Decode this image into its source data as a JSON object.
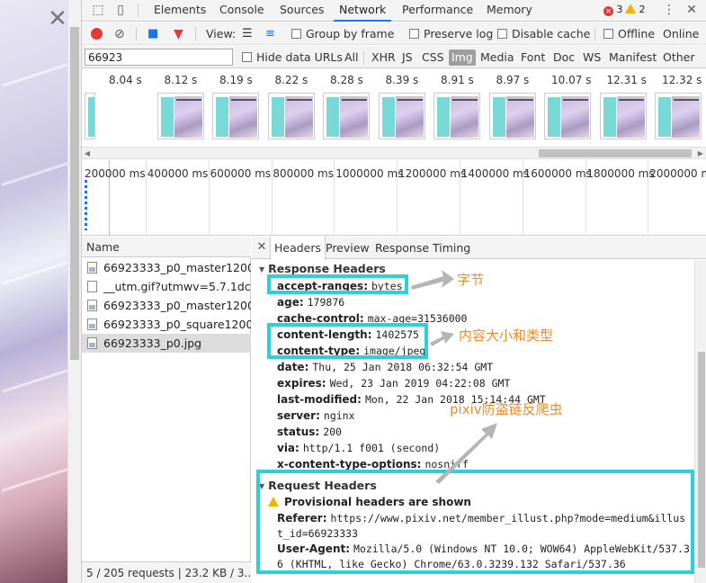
{
  "page": {
    "close_glyph": "✕"
  },
  "devtools": {
    "main_tabs": [
      "Elements",
      "Console",
      "Sources",
      "Network",
      "Performance",
      "Memory"
    ],
    "active_tab": "Network",
    "error_count": "3",
    "warning_count": "2",
    "more_glyph": "⋮",
    "close_glyph": "✕"
  },
  "toolbar": {
    "view_label": "View:",
    "group_by_frame": "Group by frame",
    "preserve_log": "Preserve log",
    "disable_cache": "Disable cache",
    "offline": "Offline",
    "online": "Online"
  },
  "filter": {
    "value": "66923",
    "hide_data_urls": "Hide data URLs",
    "types": [
      "All",
      "XHR",
      "JS",
      "CSS",
      "Img",
      "Media",
      "Font",
      "Doc",
      "WS",
      "Manifest",
      "Other"
    ],
    "active_type": "Img"
  },
  "filmstrip": {
    "times": [
      "8.04 s",
      "8.12 s",
      "8.19 s",
      "8.22 s",
      "8.28 s",
      "8.39 s",
      "8.91 s",
      "8.97 s",
      "10.07 s",
      "12.31 s",
      "12.32 s"
    ]
  },
  "timeline": {
    "ticks": [
      "200000 ms",
      "400000 ms",
      "600000 ms",
      "800000 ms",
      "1000000 ms",
      "1200000 ms",
      "1400000 ms",
      "1600000 ms",
      "1800000 ms",
      "2000000 ms"
    ]
  },
  "request_list": {
    "header": "Name",
    "rows": [
      {
        "name": "66923333_p0_master1200...",
        "icon": "image-file-icon"
      },
      {
        "name": "__utm.gif?utmwv=5.7.1dc...",
        "icon": "blank-file-icon"
      },
      {
        "name": "66923333_p0_master1200...",
        "icon": "image-file-icon"
      },
      {
        "name": "66923333_p0_square1200...",
        "icon": "image-file-icon"
      },
      {
        "name": "66923333_p0.jpg",
        "icon": "image-file-icon"
      }
    ],
    "status": "5 / 205 requests | 23.2 KB / 3..."
  },
  "details": {
    "close_glyph": "✕",
    "tabs": [
      "Headers",
      "Preview",
      "Response",
      "Timing"
    ],
    "active_tab": "Headers",
    "response_headers_title": "Response Headers",
    "response_headers": [
      {
        "k": "accept-ranges:",
        "v": "bytes"
      },
      {
        "k": "age:",
        "v": "179876"
      },
      {
        "k": "cache-control:",
        "v": "max-age=31536000"
      },
      {
        "k": "content-length:",
        "v": "1402575"
      },
      {
        "k": "content-type:",
        "v": "image/jpeg"
      },
      {
        "k": "date:",
        "v": "Thu, 25 Jan 2018 06:32:54 GMT"
      },
      {
        "k": "expires:",
        "v": "Wed, 23 Jan 2019 04:22:08 GMT"
      },
      {
        "k": "last-modified:",
        "v": "Mon, 22 Jan 2018 15:14:44 GMT"
      },
      {
        "k": "server:",
        "v": "nginx"
      },
      {
        "k": "status:",
        "v": "200"
      },
      {
        "k": "via:",
        "v": "http/1.1 f001 (second)"
      },
      {
        "k": "x-content-type-options:",
        "v": "nosniff"
      }
    ],
    "request_headers_title": "Request Headers",
    "provisional_warning": "Provisional headers are shown",
    "referer_key": "Referer:",
    "referer_value": "https://www.pixiv.net/member_illust.php?mode=medium&illust_id=66923333",
    "ua_key": "User-Agent:",
    "ua_value": "Mozilla/5.0 (Windows NT 10.0; WOW64) AppleWebKit/537.36 (KHTML, like Gecko) Chrome/63.0.3239.132 Safari/537.36"
  },
  "annotations": {
    "bytes_note": "字节",
    "size_type_note": "内容大小和类型",
    "anti_hotlink_note": "pixiv防盗链反爬虫",
    "color_box": "#2bd1d6",
    "color_text": "#f08a2a",
    "color_arrow": "#b5b5b5"
  }
}
